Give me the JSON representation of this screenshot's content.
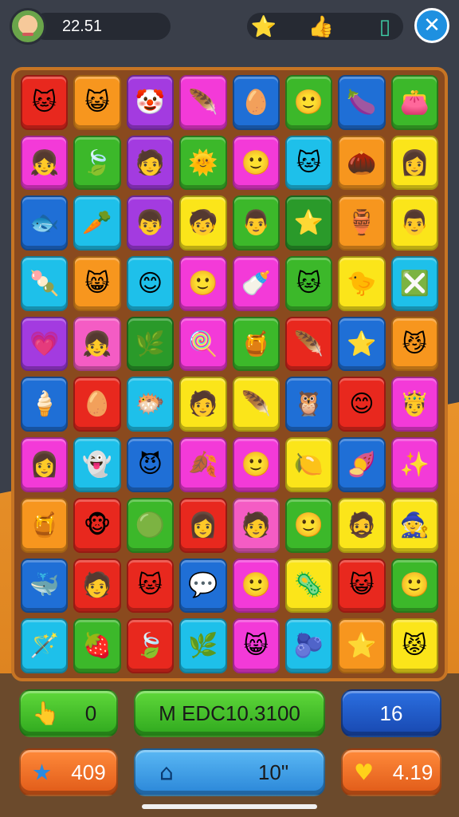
{
  "header": {
    "score": "22.51",
    "resources": [
      {
        "icon": "star-icon",
        "glyph": "⭐"
      },
      {
        "icon": "hand-icon",
        "glyph": "👍"
      },
      {
        "icon": "card-icon",
        "glyph": "▯"
      }
    ],
    "close_glyph": "✕"
  },
  "board": {
    "rows": 10,
    "cols": 8,
    "tiles": [
      [
        [
          "orange-cat-face",
          "c-red",
          "🐱"
        ],
        [
          "cat-face",
          "c-orange",
          "😺"
        ],
        [
          "clown-face",
          "c-purple",
          "🤡"
        ],
        [
          "feather",
          "c-magenta",
          "🪶"
        ],
        [
          "egg",
          "c-blue",
          "🥚"
        ],
        [
          "person-face",
          "c-green",
          "🙂"
        ],
        [
          "eggplant",
          "c-blue",
          "🍆"
        ],
        [
          "pink-bag",
          "c-green",
          "👛"
        ]
      ],
      [
        [
          "person-face",
          "c-magenta",
          "👧"
        ],
        [
          "green-leaf",
          "c-green",
          "🍃"
        ],
        [
          "person-face",
          "c-purple",
          "🧑"
        ],
        [
          "sun-face",
          "c-green",
          "🌞"
        ],
        [
          "blue-person-face",
          "c-magenta",
          "🙂"
        ],
        [
          "cat-face",
          "c-cyan",
          "🐱"
        ],
        [
          "radish",
          "c-orange",
          "🌰"
        ],
        [
          "person-face",
          "c-yellow",
          "👩"
        ]
      ],
      [
        [
          "fish",
          "c-blue",
          "🐟"
        ],
        [
          "carrot",
          "c-cyan",
          "🥕"
        ],
        [
          "person-face",
          "c-purple",
          "👦"
        ],
        [
          "person-face",
          "c-yellow",
          "🧒"
        ],
        [
          "person-face",
          "c-green",
          "👨"
        ],
        [
          "star",
          "c-darkgreen",
          "⭐"
        ],
        [
          "pot",
          "c-orange",
          "🏺"
        ],
        [
          "person-face",
          "c-yellow",
          "👨"
        ]
      ],
      [
        [
          "popsicle",
          "c-cyan",
          "🍡"
        ],
        [
          "cat-face",
          "c-orange",
          "😸"
        ],
        [
          "person-face",
          "c-cyan",
          "😊"
        ],
        [
          "person-face",
          "c-magenta",
          "🙂"
        ],
        [
          "bottle",
          "c-magenta",
          "🍼"
        ],
        [
          "cat-face",
          "c-green",
          "🐱"
        ],
        [
          "chick",
          "c-yellow",
          "🐤"
        ],
        [
          "cross-box",
          "c-cyan",
          "❎"
        ]
      ],
      [
        [
          "heart",
          "c-purple",
          "💗"
        ],
        [
          "person-face",
          "c-pink",
          "👧"
        ],
        [
          "leaf",
          "c-darkgreen",
          "🌿"
        ],
        [
          "lollipop",
          "c-magenta",
          "🍭"
        ],
        [
          "beehive",
          "c-green",
          "🍯"
        ],
        [
          "feather",
          "c-red",
          "🪶"
        ],
        [
          "star",
          "c-blue",
          "⭐"
        ],
        [
          "cat-face",
          "c-orange",
          "😼"
        ]
      ],
      [
        [
          "ice-cream",
          "c-blue",
          "🍦"
        ],
        [
          "egg",
          "c-red",
          "🥚"
        ],
        [
          "fish-face",
          "c-cyan",
          "🐡"
        ],
        [
          "person-face",
          "c-yellow",
          "🧑"
        ],
        [
          "feather",
          "c-yellow",
          "🪶"
        ],
        [
          "owl",
          "c-blue",
          "🦉"
        ],
        [
          "smiley-face",
          "c-red",
          "😊"
        ],
        [
          "person-face",
          "c-magenta",
          "🤴"
        ]
      ],
      [
        [
          "person-face",
          "c-magenta",
          "👩"
        ],
        [
          "ghost-face",
          "c-cyan",
          "👻"
        ],
        [
          "purple-face",
          "c-blue",
          "😈"
        ],
        [
          "leaf",
          "c-magenta",
          "🍂"
        ],
        [
          "person-face",
          "c-magenta",
          "🙂"
        ],
        [
          "lemon",
          "c-yellow",
          "🍋"
        ],
        [
          "radish",
          "c-blue",
          "🍠"
        ],
        [
          "star",
          "c-magenta",
          "✨"
        ]
      ],
      [
        [
          "honey-pot",
          "c-orange",
          "🍯"
        ],
        [
          "monkey-face",
          "c-red",
          "🐵"
        ],
        [
          "green-face",
          "c-green",
          "🟢"
        ],
        [
          "person-face",
          "c-red",
          "👩"
        ],
        [
          "person-face",
          "c-pink",
          "🧑"
        ],
        [
          "green-face",
          "c-green",
          "🙂"
        ],
        [
          "person-face",
          "c-yellow",
          "🧔"
        ],
        [
          "person-face",
          "c-yellow",
          "🧙"
        ]
      ],
      [
        [
          "whale",
          "c-blue",
          "🐳"
        ],
        [
          "person-face",
          "c-red",
          "🧑"
        ],
        [
          "cat-face",
          "c-red",
          "🐱"
        ],
        [
          "speech-bubble",
          "c-blue",
          "💬"
        ],
        [
          "person-face",
          "c-magenta",
          "🙂"
        ],
        [
          "bug",
          "c-yellow",
          "🦠"
        ],
        [
          "cat-face",
          "c-red",
          "😺"
        ],
        [
          "round-face",
          "c-green",
          "🙂"
        ]
      ],
      [
        [
          "wand",
          "c-cyan",
          "🪄"
        ],
        [
          "strawberry",
          "c-green",
          "🍓"
        ],
        [
          "leaf",
          "c-red",
          "🍃"
        ],
        [
          "leaf",
          "c-cyan",
          "🌿"
        ],
        [
          "cat-face",
          "c-magenta",
          "😸"
        ],
        [
          "berry",
          "c-cyan",
          "🫐"
        ],
        [
          "star",
          "c-orange",
          "⭐"
        ],
        [
          "cat-face",
          "c-yellow",
          "😾"
        ]
      ]
    ]
  },
  "buttons": {
    "left_top": {
      "label": "0",
      "icon": "hand-icon",
      "glyph": "👆"
    },
    "center_top": {
      "label": "M EDC10.3100"
    },
    "right_top": {
      "label": "16"
    },
    "left_bottom": {
      "label": "409",
      "icon": "star-icon",
      "glyph": "★"
    },
    "center_bottom": {
      "label": "10\"",
      "icon": "house-icon",
      "glyph": "⌂"
    },
    "right_bottom": {
      "label": "4.19",
      "icon": "heart-icon",
      "glyph": "♥"
    }
  }
}
